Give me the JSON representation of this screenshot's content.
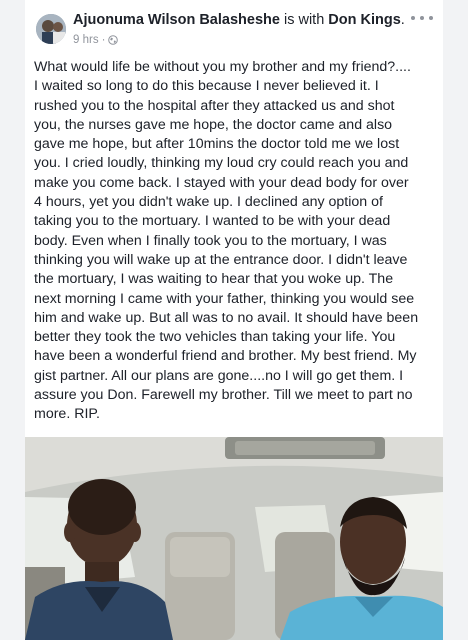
{
  "post": {
    "author": "Ajuonuma Wilson Balasheshe",
    "with_text": " is with ",
    "tagged": "Don Kings",
    "tagged_suffix": ".",
    "time": "9 hrs",
    "separator": "·",
    "privacy_icon": "globe-icon",
    "more_icon": "more-options-icon",
    "text": "What would life be without you my brother and my friend?....\nI waited so long to do this because I never believed it. I\nrushed you to the hospital after they attacked us and shot\nyou, the nurses gave me hope, the doctor came and also\ngave me hope, but after 10mins the doctor told me we lost\nyou. I cried loudly, thinking my loud cry could reach you and\nmake you come back. I stayed with your dead body for over\n4 hours, yet you didn't wake up. I declined any option of\ntaking you to the mortuary. I wanted to be with your dead\nbody. Even when I finally took you to the mortuary, I was\nthinking you will wake up at the entrance door. I didn't leave\nthe mortuary, I was waiting to hear that you woke up. The\nnext morning I came with your father, thinking you would see\nhim and wake up. But all was to no avail. It should have been\nbetter they took the two vehicles than taking your life. You\nhave been a wonderful friend and brother. My best friend. My\ngist partner. All our plans are gone....no I will go get them. I\nassure you Don. Farewell my brother. Till we meet to part no\nmore. RIP."
  },
  "colors": {
    "text": "#1d2129",
    "meta": "#90949c",
    "background": "#f2f3f5"
  }
}
